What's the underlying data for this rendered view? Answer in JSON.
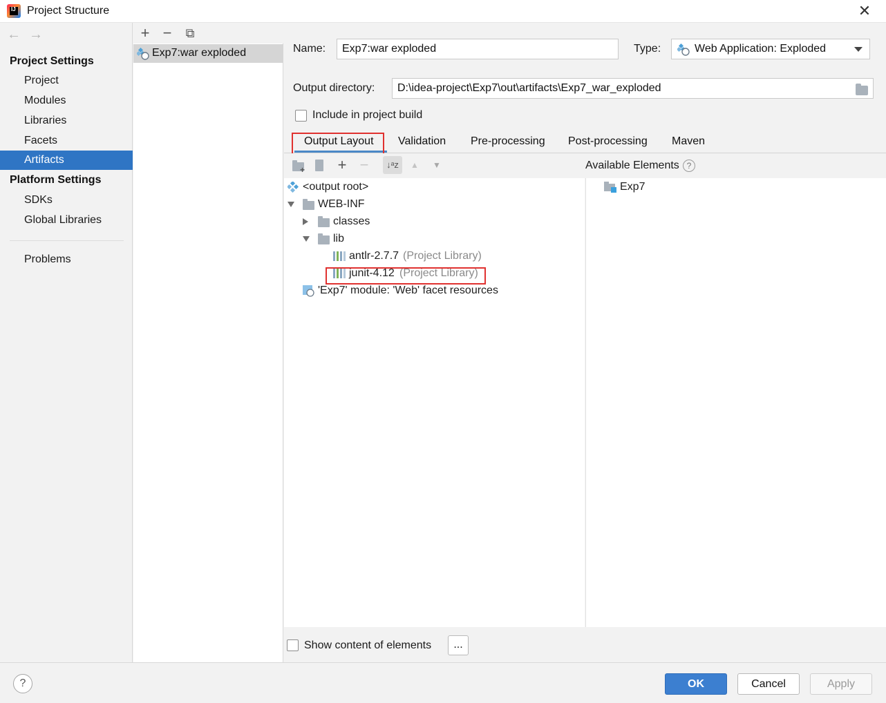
{
  "window": {
    "title": "Project Structure",
    "close_glyph": "✕"
  },
  "sidebar": {
    "back_glyph": "←",
    "forward_glyph": "→",
    "project_settings_header": "Project Settings",
    "project_items": [
      "Project",
      "Modules",
      "Libraries",
      "Facets",
      "Artifacts"
    ],
    "selected_item": "Artifacts",
    "platform_settings_header": "Platform Settings",
    "platform_items": [
      "SDKs",
      "Global Libraries"
    ],
    "problems_label": "Problems"
  },
  "artifacts_list": {
    "toolbar": {
      "add_glyph": "+",
      "remove_glyph": "−",
      "copy_glyph": "⧉"
    },
    "items": [
      {
        "label": "Exp7:war exploded",
        "icon": "web-artifact-icon"
      }
    ]
  },
  "artifact": {
    "name_label": "Name:",
    "name_value": "Exp7:war exploded",
    "type_label": "Type:",
    "type_value": "Web Application: Exploded",
    "output_dir_label": "Output directory:",
    "output_dir_value": "D:\\idea-project\\Exp7\\out\\artifacts\\Exp7_war_exploded",
    "include_build_label": "Include in project build",
    "include_build_checked": false
  },
  "tabs": [
    "Output Layout",
    "Validation",
    "Pre-processing",
    "Post-processing",
    "Maven"
  ],
  "active_tab": "Output Layout",
  "layout_toolbar": {
    "add_glyph": "+",
    "remove_glyph": "−",
    "up_glyph": "▲",
    "down_glyph": "▼",
    "sort_glyph": "↓ᵃz"
  },
  "output_tree": {
    "root": "<output root>",
    "web_inf": "WEB-INF",
    "classes": "classes",
    "lib": "lib",
    "libs": [
      {
        "name": "antlr-2.7.7",
        "suffix": "(Project Library)"
      },
      {
        "name": "junit-4.12",
        "suffix": "(Project Library)"
      }
    ],
    "facet_resources": "'Exp7' module: 'Web' facet resources"
  },
  "available": {
    "header": "Available Elements",
    "help_glyph": "?",
    "items": [
      "Exp7"
    ]
  },
  "show_content": {
    "label": "Show content of elements",
    "checked": false,
    "ellipsis_button": "..."
  },
  "buttons": {
    "help": "?",
    "ok": "OK",
    "cancel": "Cancel",
    "apply": "Apply"
  },
  "colors": {
    "selection": "#2f75c4",
    "highlight_box": "#e0312f",
    "ok_button": "#3c7fd0"
  }
}
